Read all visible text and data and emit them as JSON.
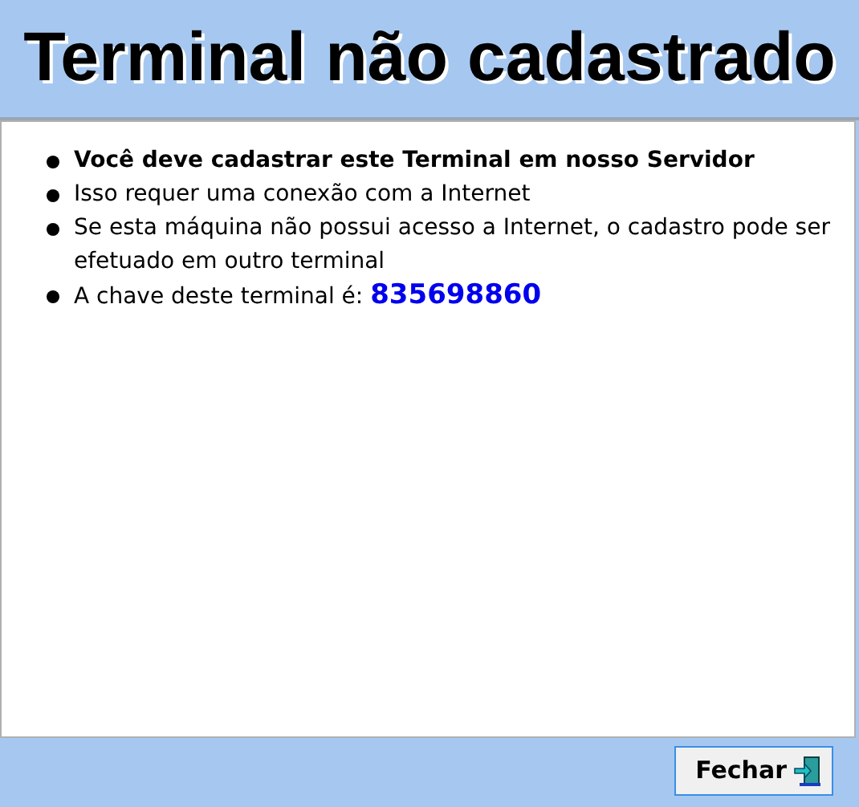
{
  "title": "Terminal não cadastrado",
  "items": [
    {
      "text": "Você deve cadastrar este Terminal em nosso Servidor",
      "bold": true
    },
    {
      "text": "Isso requer uma conexão com a Internet",
      "bold": false
    },
    {
      "text": "Se esta máquina não possui acesso a Internet, o cadastro pode ser efetuado em outro terminal",
      "bold": false
    },
    {
      "text": "A chave deste terminal é:",
      "bold": false,
      "key": "835698860"
    }
  ],
  "button": "Fechar"
}
